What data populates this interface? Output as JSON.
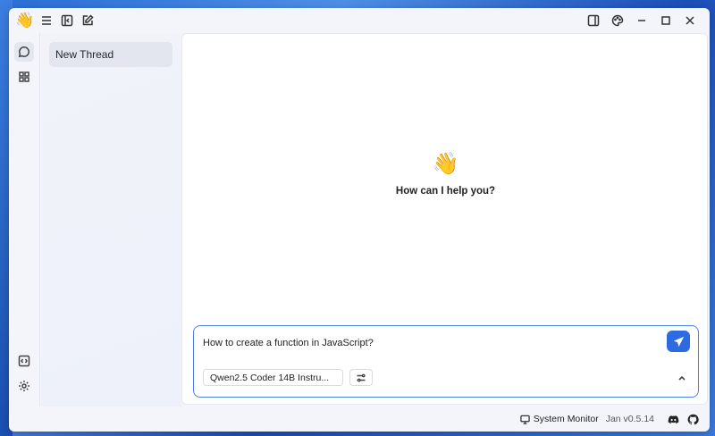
{
  "app": {
    "logo_emoji": "👋"
  },
  "titlebar": {
    "icons": [
      "menu-icon",
      "sidebar-collapse-icon",
      "edit-icon"
    ],
    "right_icons": [
      "panel-right-icon",
      "palette-icon",
      "minimize-icon",
      "maximize-icon",
      "close-icon"
    ]
  },
  "rail": {
    "items": [
      "chat-icon",
      "apps-grid-icon"
    ],
    "bottom_items": [
      "code-icon",
      "settings-icon"
    ]
  },
  "threads": {
    "items": [
      {
        "label": "New Thread"
      }
    ]
  },
  "main": {
    "welcome_emoji": "👋",
    "welcome_text": "How can I help you?"
  },
  "composer": {
    "input_value": "How to create a function in JavaScript?",
    "model_label": "Qwen2.5 Coder 14B Instru...",
    "accent": "#2f6be0"
  },
  "statusbar": {
    "system_monitor": "System Monitor",
    "version": "Jan v0.5.14"
  }
}
